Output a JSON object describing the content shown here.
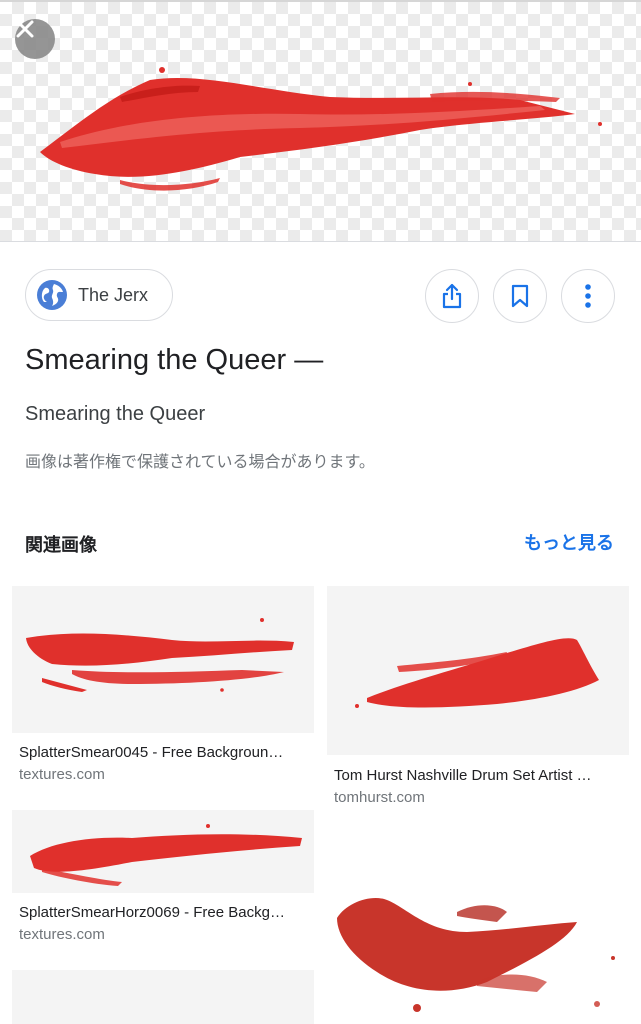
{
  "preview": {
    "close_icon": "close-icon",
    "accent_color": "#e0302c"
  },
  "source": {
    "name": "The Jerx",
    "icon": "globe-icon"
  },
  "actions": {
    "share_icon": "share-icon",
    "bookmark_icon": "bookmark-icon",
    "more_icon": "more-vert-icon"
  },
  "title": "Smearing the Queer —",
  "subtitle": "Smearing the Queer",
  "copyright_notice": "画像は著作権で保護されている場合があります。",
  "related": {
    "heading": "関連画像",
    "more_label": "もっと見る",
    "items": [
      {
        "title": "SplatterSmear0045 - Free Backgroun…",
        "source": "textures.com"
      },
      {
        "title": "Tom Hurst Nashville Drum Set Artist …",
        "source": "tomhurst.com"
      },
      {
        "title": "SplatterSmearHorz0069 - Free Backg…",
        "source": "textures.com"
      },
      {
        "title": "",
        "source": ""
      },
      {
        "title": "",
        "source": ""
      }
    ]
  }
}
